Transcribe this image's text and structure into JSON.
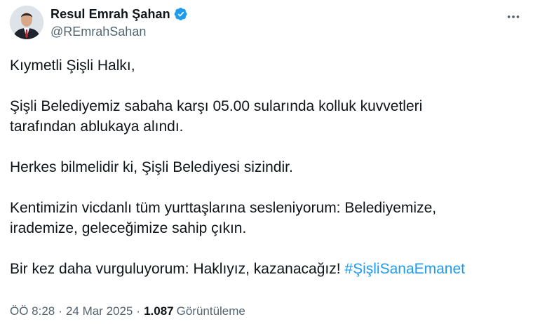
{
  "author": {
    "name": "Resul Emrah Şahan",
    "handle": "@REmrahSahan",
    "verified": true,
    "avatar_icon": "profile-photo",
    "verified_icon": "verified-badge-icon",
    "verified_color": "#1d9bf0"
  },
  "more_icon": "ellipsis-icon",
  "tweet": {
    "line1": "Kıymetli Şişli Halkı,",
    "line2": "Şişli Belediyemiz sabaha karşı 05.00 sularında kolluk kuvvetleri",
    "line3": "tarafından ablukaya alındı.",
    "line4": "Herkes bilmelidir ki, Şişli Belediyesi sizindir.",
    "line5": "Kentimizin vicdanlı tüm yurttaşlarına sesleniyorum: Belediyemize,",
    "line6": "irademize, geleceğimize sahip çıkın.",
    "line7": "Bir kez daha vurguluyorum: Haklıyız, kazanacağız! ",
    "hashtag": "#ŞişliSanaEmanet"
  },
  "meta": {
    "time": "ÖÖ 8:28",
    "separator": "·",
    "date": "24 Mar 2025",
    "views_count": "1.087",
    "views_label": "Görüntüleme"
  },
  "colors": {
    "text": "#0f1419",
    "secondary": "#536471",
    "link": "#1d9bf0"
  }
}
